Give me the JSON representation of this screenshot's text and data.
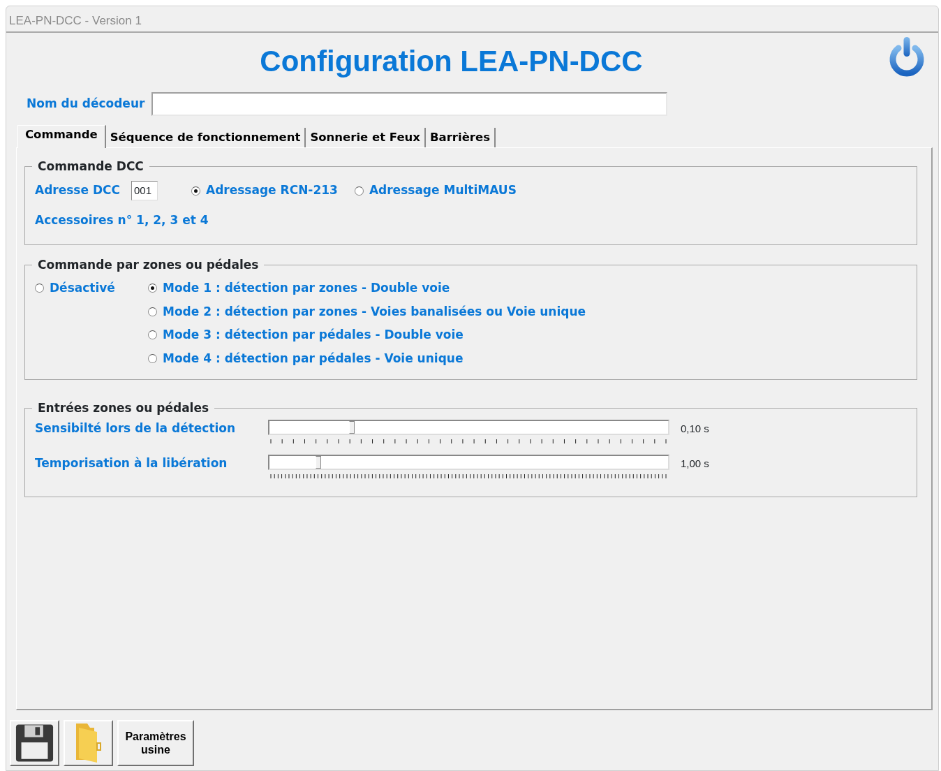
{
  "window": {
    "title": "LEA-PN-DCC - Version 1"
  },
  "heading": "Configuration LEA-PN-DCC",
  "decoder_name": {
    "label": "Nom du décodeur"
  },
  "tabs": [
    {
      "label": "Commande",
      "selected": true
    },
    {
      "label": "Séquence de fonctionnement",
      "selected": false
    },
    {
      "label": "Sonnerie et Feux",
      "selected": false
    },
    {
      "label": "Barrières",
      "selected": false
    }
  ],
  "dcc_group": {
    "legend": "Commande DCC",
    "address_label": "Adresse DCC",
    "address_value": "001",
    "addressing": [
      {
        "label": "Adressage RCN-213",
        "selected": true
      },
      {
        "label": "Adressage MultiMAUS",
        "selected": false
      }
    ],
    "note": "Accessoires n° 1, 2, 3 et 4"
  },
  "zones_group": {
    "legend": "Commande par zones ou pédales",
    "disabled_option": {
      "label": "Désactivé",
      "selected": false
    },
    "modes": [
      {
        "label": "Mode 1 : détection par zones - Double voie",
        "selected": true
      },
      {
        "label": "Mode 2 : détection par zones - Voies banalisées ou Voie unique",
        "selected": false
      },
      {
        "label": "Mode 3 : détection par pédales - Double voie",
        "selected": false
      },
      {
        "label": "Mode 4 : détection par pédales - Voie unique",
        "selected": false
      }
    ]
  },
  "inputs_group": {
    "legend": "Entrées zones ou pédales",
    "sliders": [
      {
        "label": "Sensibilté lors de la détection",
        "level": 0.2,
        "reading": "0,10 s"
      },
      {
        "label": "Temporisation à la libération",
        "level": 0.115,
        "reading": "1,00 s"
      }
    ]
  },
  "buttons": [
    {
      "kind": "save"
    },
    {
      "kind": "open"
    },
    {
      "kind": "text",
      "label": "Paramètres usine"
    }
  ]
}
